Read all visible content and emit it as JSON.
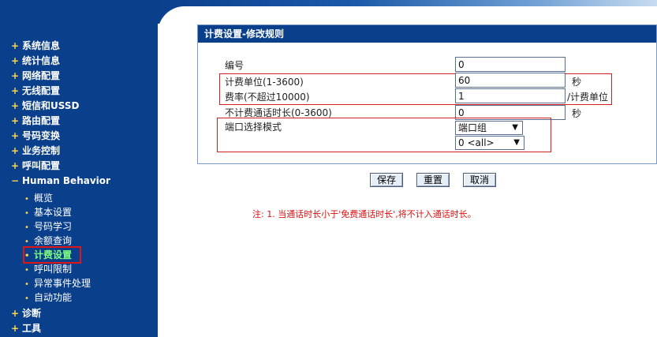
{
  "sidebar": {
    "items": [
      {
        "label": "系统信息",
        "expand": "+"
      },
      {
        "label": "统计信息",
        "expand": "+"
      },
      {
        "label": "网络配置",
        "expand": "+"
      },
      {
        "label": "无线配置",
        "expand": "+"
      },
      {
        "label": "短信和USSD",
        "expand": "+"
      },
      {
        "label": "路由配置",
        "expand": "+"
      },
      {
        "label": "号码变换",
        "expand": "+"
      },
      {
        "label": "业务控制",
        "expand": "+"
      },
      {
        "label": "呼叫配置",
        "expand": "+"
      },
      {
        "label": "Human Behavior",
        "expand": "−"
      }
    ],
    "subitems": [
      "概览",
      "基本设置",
      "号码学习",
      "余额查询",
      "计费设置",
      "呼叫限制",
      "异常事件处理",
      "自动功能"
    ],
    "items_after": [
      {
        "label": "诊断",
        "expand": "+"
      },
      {
        "label": "工具",
        "expand": "+"
      }
    ],
    "bullet": "•"
  },
  "panel": {
    "title": "计费设置-修改规则",
    "fields": {
      "number": {
        "label": "编号",
        "value": "0"
      },
      "billing_unit": {
        "label": "计费单位(1-3600)",
        "value": "60",
        "unit": "秒"
      },
      "rate": {
        "label": "费率(不超过10000)",
        "value": "1",
        "unit": "/计费单位"
      },
      "free_duration": {
        "label": "不计费通话时长(0-3600)",
        "value": "0",
        "unit": "秒"
      },
      "port_mode": {
        "label": "端口选择模式",
        "value": "端口组",
        "secondary_value": "0 <all>"
      }
    }
  },
  "buttons": {
    "save": "保存",
    "reset": "重置",
    "cancel": "取消"
  },
  "note": "注: 1. 当通话时长小于'免费通话时长',将不计入通话时长。",
  "colors": {
    "sidebar": "#0a3f8c",
    "highlight_border": "#e01515",
    "note": "#e01010",
    "active_item": "#7dff7d"
  }
}
